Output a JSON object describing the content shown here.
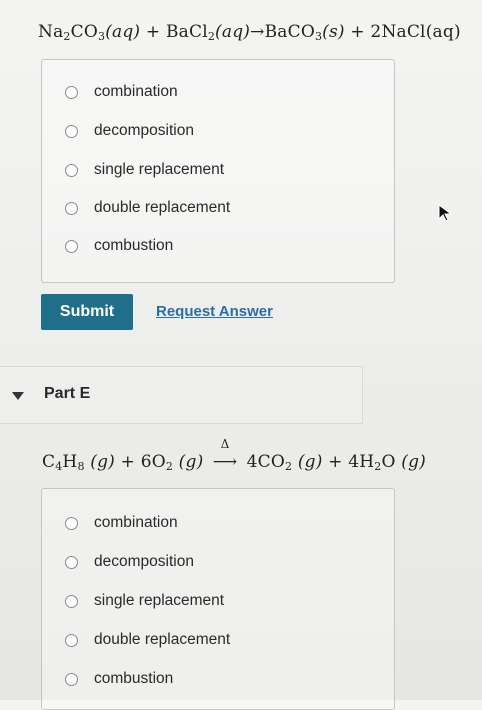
{
  "question_d": {
    "equation": {
      "r1": "Na",
      "r1_sub1": "2",
      "r1_mid": "CO",
      "r1_sub2": "3",
      "r1_state": "(aq)",
      "plus1": "+",
      "r2": "BaCl",
      "r2_sub": "2",
      "r2_state": "(aq)",
      "arrow": "→",
      "p1": "BaCO",
      "p1_sub": "3",
      "p1_state": "(s)",
      "plus2": "+",
      "p2": "2NaCl(aq)"
    },
    "choices": [
      "combination",
      "decomposition",
      "single replacement",
      "double replacement",
      "combustion"
    ],
    "submit_label": "Submit",
    "request_answer_label": "Request Answer"
  },
  "part_e": {
    "title": "Part E",
    "equation": {
      "r1_a": "C",
      "r1_sub1": "4",
      "r1_b": "H",
      "r1_sub2": "8",
      "r1_state": "(g)",
      "plus1": "+",
      "r2": "6O",
      "r2_sub": "2",
      "r2_state": "(g)",
      "delta": "Δ",
      "arrow": "⟶",
      "p1": "4CO",
      "p1_sub": "2",
      "p1_state": "(g)",
      "plus2": "+",
      "p2": "4H",
      "p2_sub": "2",
      "p2_b": "O",
      "p2_state": "(g)"
    },
    "choices": [
      "combination",
      "decomposition",
      "single replacement",
      "double replacement",
      "combustion"
    ]
  },
  "icons": {
    "expand": "caret-down-icon",
    "pointer": "mouse-pointer-icon"
  },
  "colors": {
    "submit_bg": "#1f6e8a",
    "link": "#2a6fa8"
  }
}
